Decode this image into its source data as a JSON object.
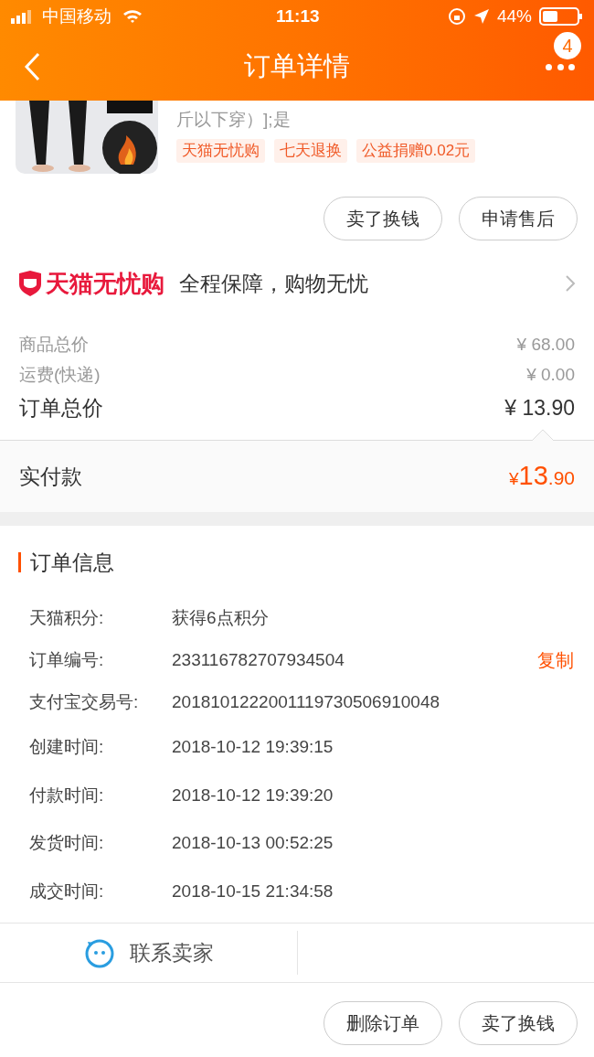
{
  "status_bar": {
    "carrier": "中国移动",
    "time": "11:13",
    "battery": "44%"
  },
  "header": {
    "title": "订单详情",
    "badge": "4"
  },
  "product": {
    "title_line": "斤以下穿）];是",
    "tags": [
      "天猫无忧购",
      "七天退换",
      "公益捐赠0.02元"
    ]
  },
  "item_actions": [
    "卖了换钱",
    "申请售后"
  ],
  "guarantee": {
    "brand": "天猫无忧购",
    "text": "全程保障，购物无忧"
  },
  "price_rows": [
    {
      "kind": "minor",
      "label": "商品总价",
      "value": "¥ 68.00"
    },
    {
      "kind": "minor",
      "label": "运费(快递)",
      "value": "¥ 0.00"
    },
    {
      "kind": "major",
      "label": "订单总价",
      "value": "¥ 13.90"
    }
  ],
  "paid": {
    "label": "实付款",
    "currency": "¥",
    "integer": "13",
    "decimal": ".90"
  },
  "order_info": {
    "title": "订单信息",
    "rows": [
      {
        "label": "天猫积分:",
        "value": "获得6点积分"
      },
      {
        "label": "订单编号:",
        "value": "233116782707934504",
        "action": "复制"
      },
      {
        "label": "支付宝交易号:",
        "value": "2018101222001119730506910048"
      },
      {
        "label": "创建时间:",
        "value": "2018-10-12 19:39:15"
      },
      {
        "label": "付款时间:",
        "value": "2018-10-12 19:39:20"
      },
      {
        "label": "发货时间:",
        "value": "2018-10-13 00:52:25"
      },
      {
        "label": "成交时间:",
        "value": "2018-10-15 21:34:58"
      }
    ]
  },
  "contact": {
    "label": "联系卖家"
  },
  "bottom_actions": [
    "删除订单",
    "卖了换钱"
  ]
}
